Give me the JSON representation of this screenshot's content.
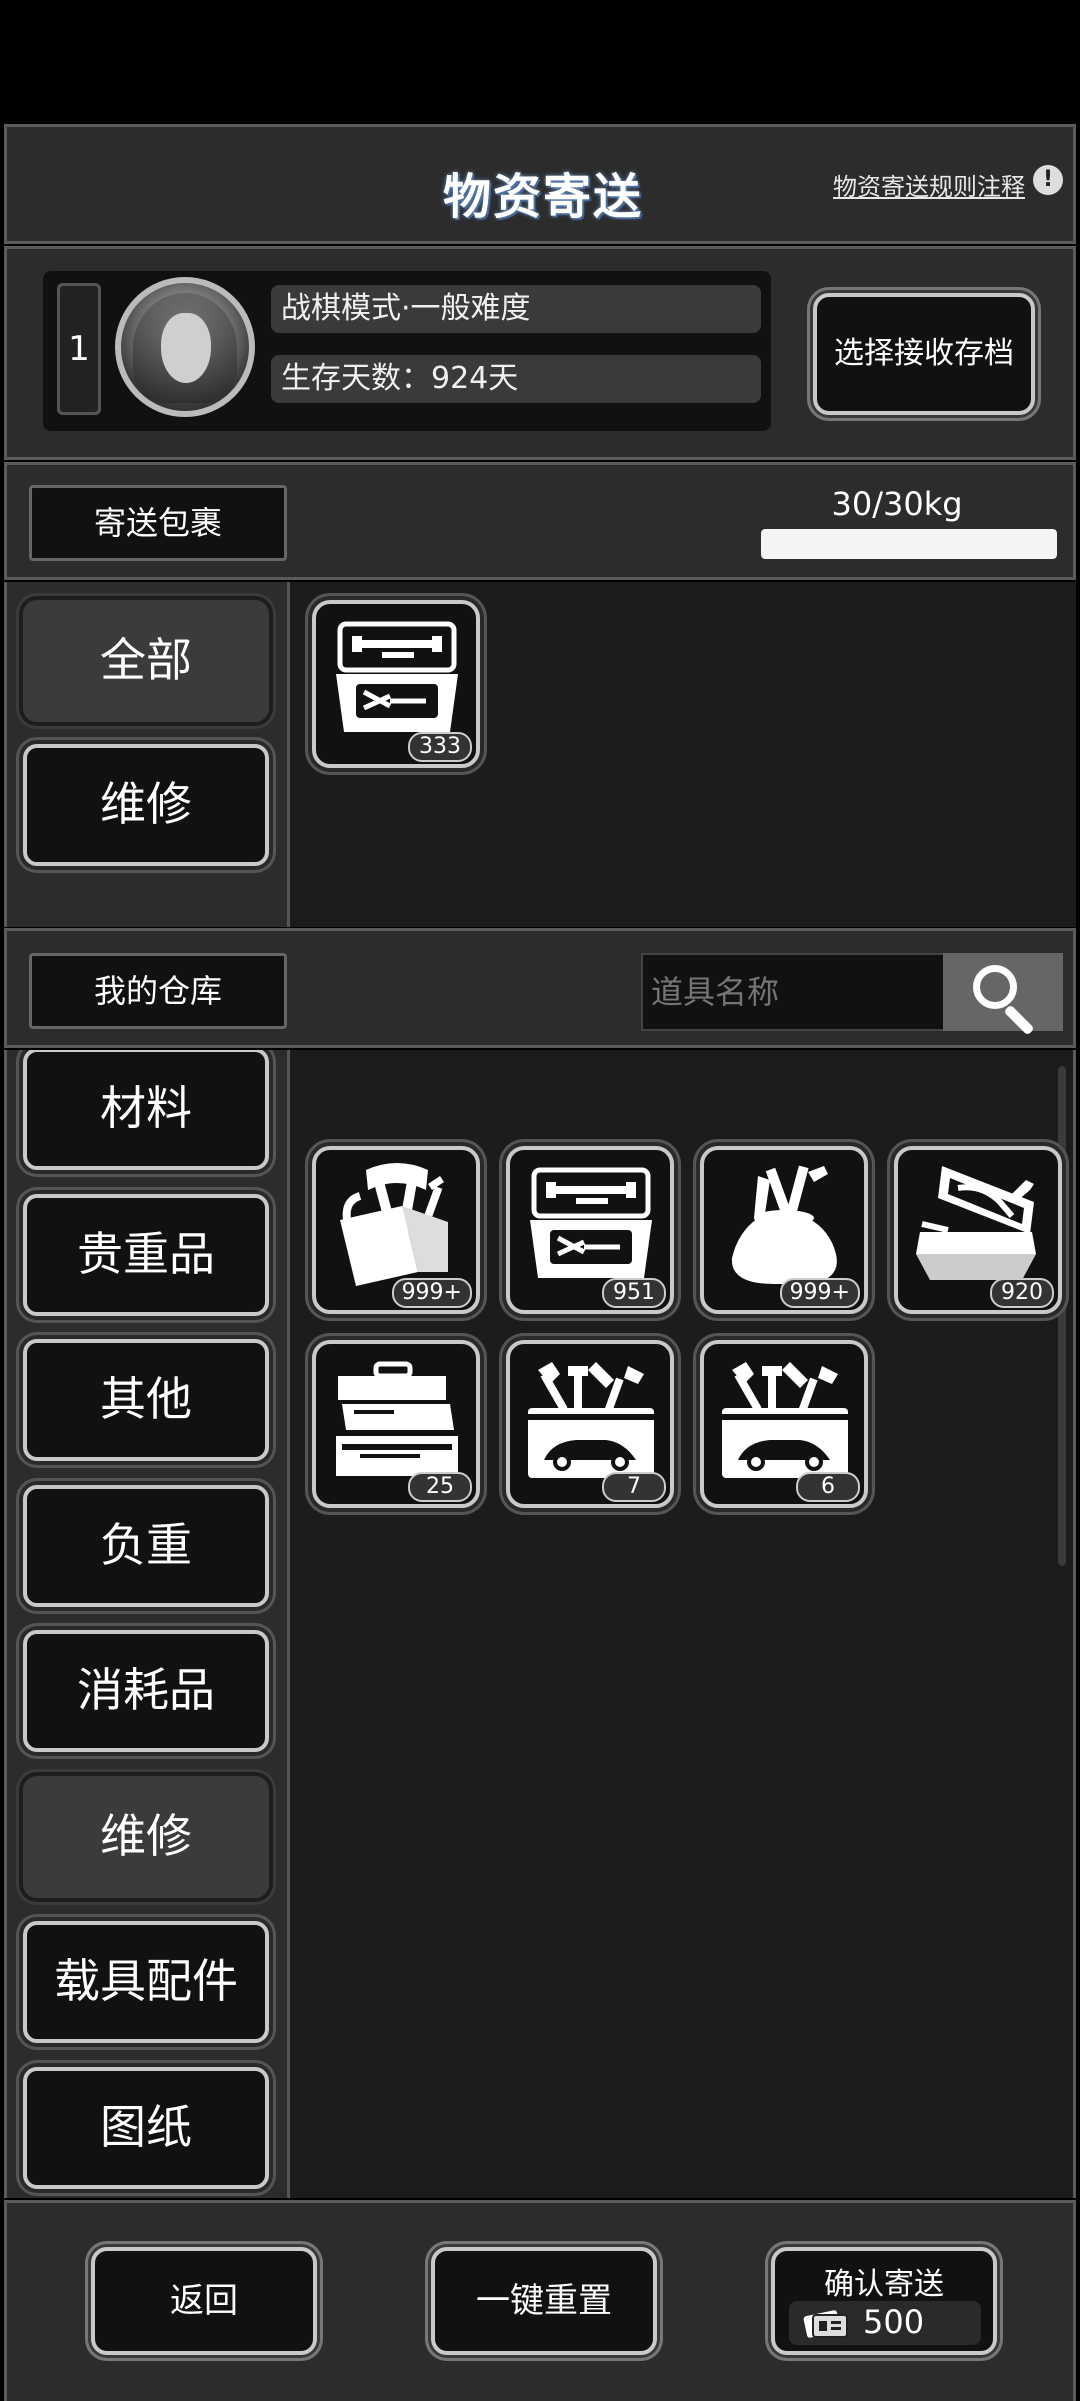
{
  "header": {
    "title": "物资寄送",
    "rules_link": "物资寄送规则注释",
    "rules_icon_glyph": "!"
  },
  "profile": {
    "slot_number": "1",
    "mode": "战棋模式·一般难度",
    "days": "生存天数：924天",
    "select_save_button": "选择接收存档"
  },
  "package": {
    "label": "寄送包裹",
    "weight_text": "30/30kg",
    "weight_fraction": 1.0,
    "categories": [
      {
        "label": "全部",
        "selected": true
      },
      {
        "label": "维修",
        "selected": false
      }
    ],
    "items": [
      {
        "icon": "toolbox-open-icon",
        "qty": "333"
      }
    ]
  },
  "warehouse": {
    "label": "我的仓库",
    "search_placeholder": "道具名称",
    "categories": [
      {
        "label": "材料",
        "selected": false
      },
      {
        "label": "贵重品",
        "selected": false
      },
      {
        "label": "其他",
        "selected": false
      },
      {
        "label": "负重",
        "selected": false
      },
      {
        "label": "消耗品",
        "selected": false
      },
      {
        "label": "维修",
        "selected": true
      },
      {
        "label": "载具配件",
        "selected": false
      },
      {
        "label": "图纸",
        "selected": false
      }
    ],
    "items": [
      {
        "icon": "tool-bag-icon",
        "qty": "999+"
      },
      {
        "icon": "toolbox-open-icon",
        "qty": "951"
      },
      {
        "icon": "tool-sack-icon",
        "qty": "999+"
      },
      {
        "icon": "pliers-case-icon",
        "qty": "920"
      },
      {
        "icon": "cantilever-toolbox-icon",
        "qty": "25"
      },
      {
        "icon": "car-repair-kit-icon",
        "qty": "7"
      },
      {
        "icon": "car-repair-kit-icon",
        "qty": "6"
      }
    ]
  },
  "footer": {
    "back_button": "返回",
    "reset_button": "一键重置",
    "confirm_label": "确认寄送",
    "cost_icon": "ticket-icon",
    "cost_value": "500"
  }
}
